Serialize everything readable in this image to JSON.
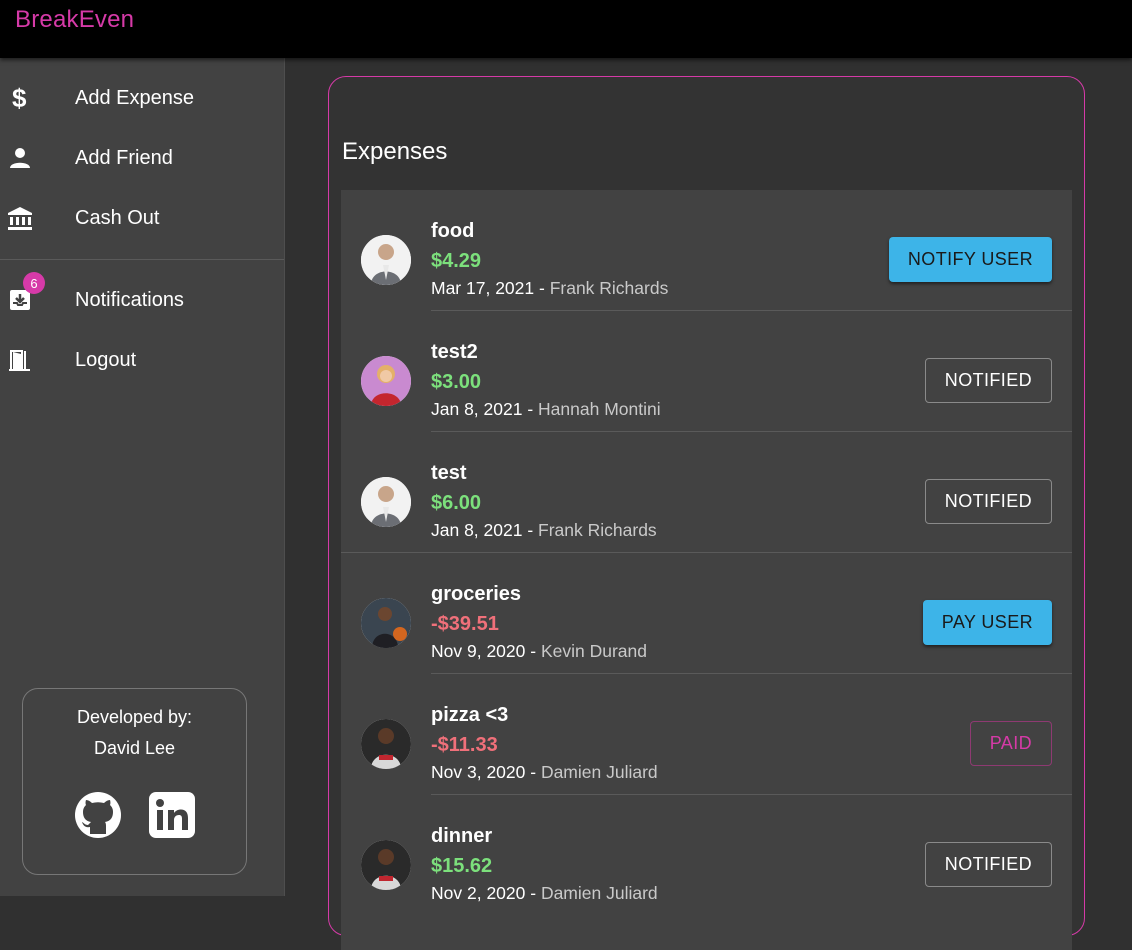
{
  "app": {
    "brand": "BreakEven"
  },
  "sidebar": {
    "items": [
      {
        "label": "Add Expense",
        "icon": "dollar-icon"
      },
      {
        "label": "Add Friend",
        "icon": "person-icon"
      },
      {
        "label": "Cash Out",
        "icon": "bank-icon"
      },
      {
        "label": "Notifications",
        "icon": "inbox-icon",
        "badge": "6"
      },
      {
        "label": "Logout",
        "icon": "door-icon"
      }
    ],
    "developer": {
      "title": "Developed by:",
      "name": "David Lee",
      "links": [
        "github-icon",
        "linkedin-icon"
      ]
    }
  },
  "main": {
    "title": "Expenses",
    "expenses": [
      {
        "title": "food",
        "amount": "$4.29",
        "sign": "positive",
        "date": "Mar 17, 2021",
        "sep": " - ",
        "person": "Frank Richards",
        "action": "NOTIFY USER",
        "action_style": "primary"
      },
      {
        "title": "test2",
        "amount": "$3.00",
        "sign": "positive",
        "date": "Jan 8, 2021",
        "sep": " - ",
        "person": "Hannah Montini",
        "action": "NOTIFIED",
        "action_style": "outline"
      },
      {
        "title": "test",
        "amount": "$6.00",
        "sign": "positive",
        "date": "Jan 8, 2021",
        "sep": " - ",
        "person": "Frank Richards",
        "action": "NOTIFIED",
        "action_style": "outline"
      },
      {
        "title": "groceries",
        "amount": "-$39.51",
        "sign": "negative",
        "date": "Nov 9, 2020",
        "sep": " - ",
        "person": "Kevin Durand",
        "action": "PAY USER",
        "action_style": "primary"
      },
      {
        "title": "pizza <3",
        "amount": "-$11.33",
        "sign": "negative",
        "date": "Nov 3, 2020",
        "sep": " - ",
        "person": "Damien Juliard",
        "action": "PAID",
        "action_style": "paid"
      },
      {
        "title": "dinner",
        "amount": "$15.62",
        "sign": "positive",
        "date": "Nov 2, 2020",
        "sep": " - ",
        "person": "Damien Juliard",
        "action": "NOTIFIED",
        "action_style": "outline"
      }
    ]
  },
  "colors": {
    "brand": "#d63aa8",
    "positive": "#7ce07c",
    "negative": "#f0707a",
    "primary_button": "#3db4e8"
  }
}
